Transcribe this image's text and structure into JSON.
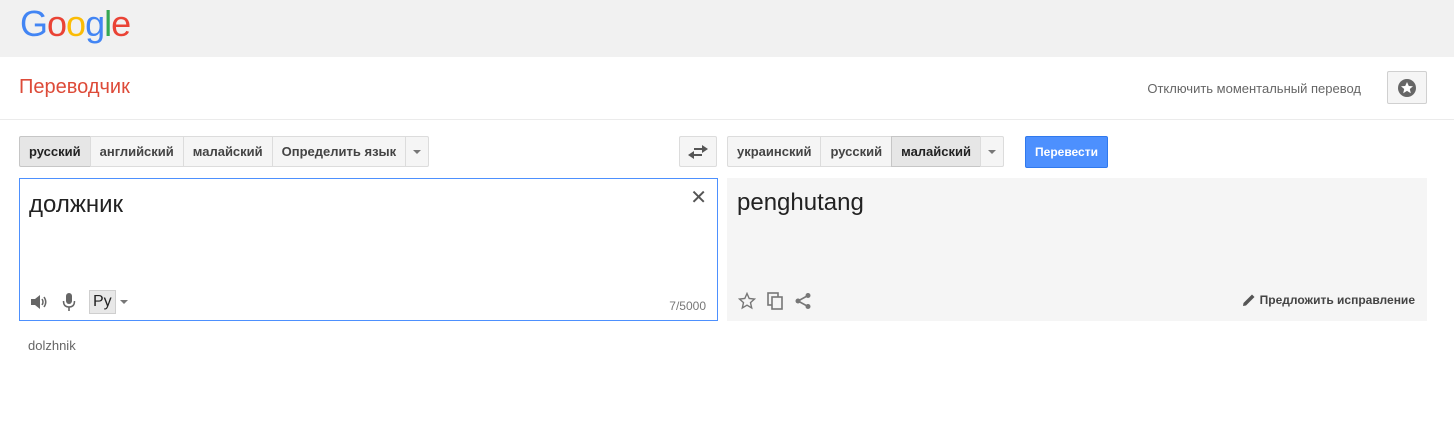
{
  "logo": {
    "letters": [
      "G",
      "o",
      "o",
      "g",
      "l",
      "e"
    ],
    "colors": [
      "#4285f4",
      "#ea4335",
      "#fbbc05",
      "#4285f4",
      "#34a853",
      "#ea4335"
    ]
  },
  "header": {
    "title": "Переводчик",
    "instant_toggle": "Отключить моментальный перевод"
  },
  "source": {
    "languages": [
      "русский",
      "английский",
      "малайский",
      "Определить язык"
    ],
    "selected": "русский",
    "text": "должник",
    "char_count": "7/5000",
    "ime_label": "Ру",
    "transliteration": "dolzhnik"
  },
  "target": {
    "languages": [
      "украинский",
      "русский",
      "малайский"
    ],
    "selected": "малайский",
    "text": "penghutang",
    "suggest_label": "Предложить исправление"
  },
  "actions": {
    "translate_label": "Перевести"
  },
  "icons": {
    "star": "star-icon",
    "swap": "swap-arrows-icon",
    "clear": "close-icon",
    "speaker": "speaker-icon",
    "mic": "microphone-icon",
    "copy": "copy-icon",
    "share": "share-icon",
    "pencil": "pencil-icon"
  },
  "colors": {
    "title": "#dd4b39",
    "accent": "#4d90fe"
  }
}
